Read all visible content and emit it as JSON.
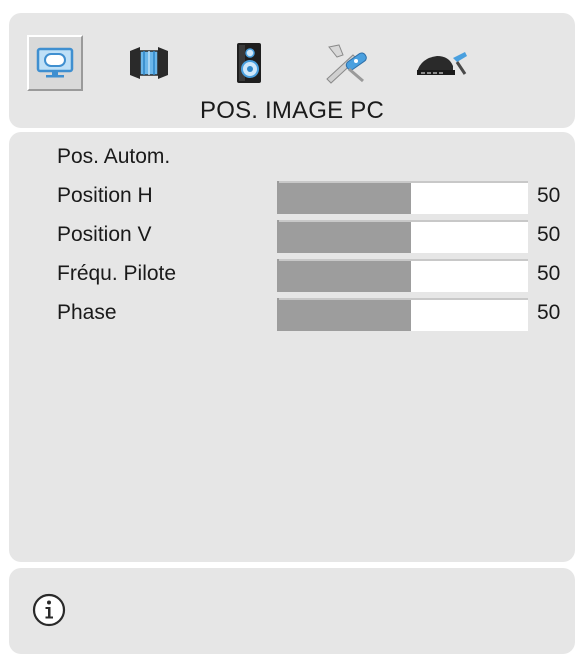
{
  "header": {
    "title": "POS. IMAGE PC",
    "tabs": [
      {
        "icon": "monitor-icon",
        "active": true
      },
      {
        "icon": "picture-adjust-icon",
        "active": false
      },
      {
        "icon": "speaker-icon",
        "active": false
      },
      {
        "icon": "tools-icon",
        "active": false
      },
      {
        "icon": "satellite-dish-icon",
        "active": false
      }
    ]
  },
  "menu": {
    "items": [
      {
        "label": "Pos. Autom."
      },
      {
        "label": "Position H",
        "value": "50",
        "level": 0.53
      },
      {
        "label": "Position V",
        "value": "50",
        "level": 0.53
      },
      {
        "label": "Fréqu. Pilote",
        "value": "50",
        "level": 0.53
      },
      {
        "label": "Phase",
        "value": "50",
        "level": 0.53
      }
    ]
  },
  "footer": {
    "icon": "info-icon"
  },
  "colors": {
    "panel": "#e6e6e6",
    "slider_fill": "#9d9d9d",
    "slider_track": "#ffffff",
    "icon_blue": "#4aa0df"
  }
}
